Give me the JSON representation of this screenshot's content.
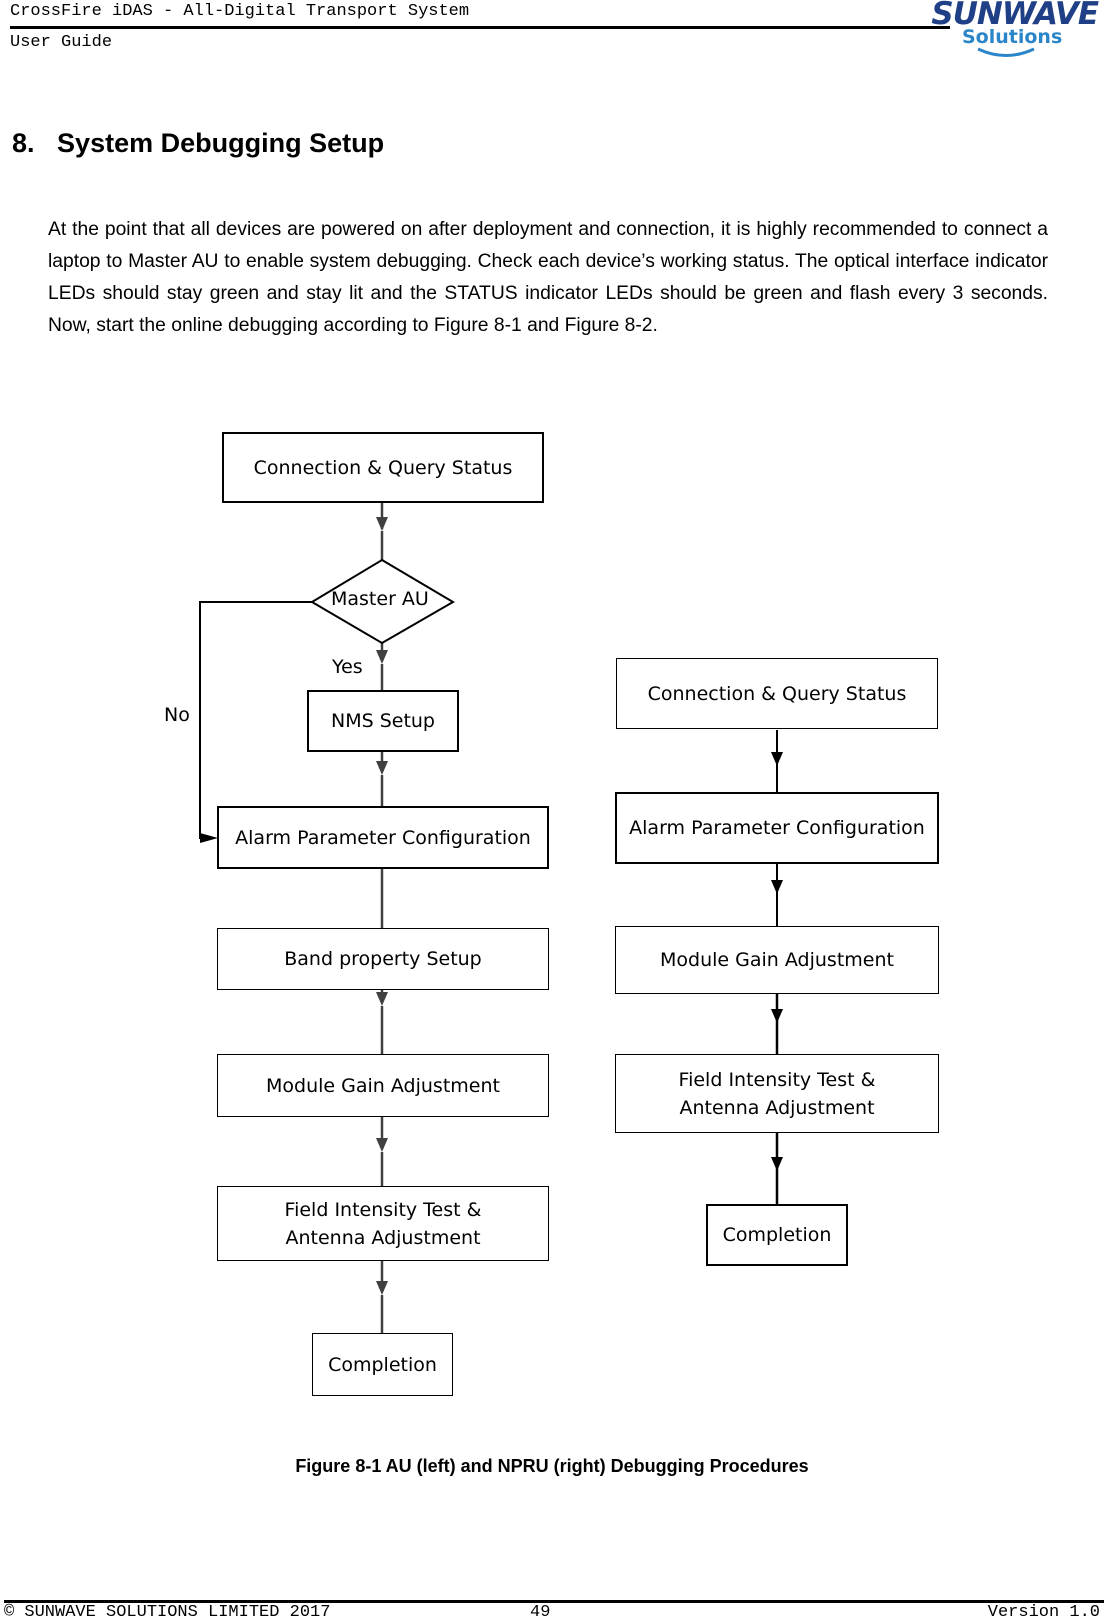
{
  "header": {
    "title": "CrossFire iDAS  - All-Digital Transport System",
    "subtitle": "User Guide",
    "logo": {
      "line1": "SUNWAVE",
      "line2": "Solutions",
      "primary_color": "#1f3f86",
      "secondary_color": "#2a86c8"
    }
  },
  "section": {
    "number": "8.",
    "title": "System Debugging Setup",
    "body": "At the point that all devices are powered on after deployment and connection, it is highly recommended to connect a laptop to Master AU to enable system debugging. Check each device’s working status. The optical interface indicator LEDs should stay green and stay lit and the STATUS indicator LEDs should be green and flash every 3 seconds. Now, start the online debugging according to Figure 8-1 and Figure 8-2."
  },
  "figure": {
    "left_flow": {
      "nodes": [
        "Connection & Query Status",
        "Master AU",
        "NMS Setup",
        "Alarm Parameter Configuration",
        "Band property Setup",
        "Module Gain Adjustment",
        "Field Intensity Test & Antenna Adjustment",
        "Completion"
      ],
      "yes_label": "Yes",
      "no_label": "No"
    },
    "right_flow": {
      "nodes": [
        "Connection & Query Status",
        "Alarm Parameter Configuration",
        "Module Gain Adjustment",
        "Field Intensity Test & Antenna Adjustment",
        "Completion"
      ]
    },
    "caption": "Figure 8-1 AU (left) and NPRU (right) Debugging Procedures"
  },
  "footer": {
    "copyright": "© SUNWAVE SOLUTIONS LIMITED 2017",
    "page": "49",
    "version": "Version 1.0"
  }
}
